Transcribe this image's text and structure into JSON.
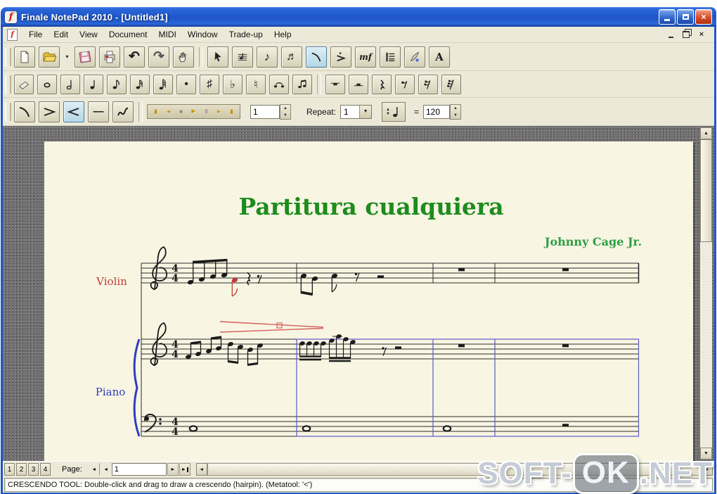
{
  "window": {
    "title": "Finale NotePad 2010 - [Untitled1]"
  },
  "menu": {
    "items": [
      "File",
      "Edit",
      "View",
      "Document",
      "MIDI",
      "Window",
      "Trade-up",
      "Help"
    ]
  },
  "transport": {
    "measure": "1",
    "repeat_label": "Repeat:",
    "repeat_value": "1",
    "equals": "=",
    "tempo": "120"
  },
  "score": {
    "title": "Partitura cualquiera",
    "composer": "Johnny Cage Jr.",
    "violin_label": "Violin",
    "piano_label": "Piano",
    "ts_top": "4",
    "ts_bottom": "4"
  },
  "page_nav": {
    "staff_sets": [
      "1",
      "2",
      "3",
      "4"
    ],
    "page_label": "Page:",
    "page_value": "1"
  },
  "status": {
    "message": "CRESCENDO TOOL: Double-click and drag to draw a crescendo (hairpin). (Metatool: '<')"
  },
  "watermark": {
    "left": "SOFT-",
    "mid": "OK",
    "right": ".NET"
  },
  "colors": {
    "titlebar_blue": "#1e55c8",
    "page_cream": "#f8f5e3",
    "title_green": "#1e8c1e",
    "violin_red": "#c03a3a",
    "piano_blue": "#2e3ec0",
    "hairpin_red": "#d96060",
    "selection_blue": "#b4d7e6"
  },
  "icons": {
    "up": "▲",
    "down": "▼",
    "open_caret": "▾",
    "dropdown": "▼",
    "undo": "↶",
    "redo": "↷",
    "sharp": "♯",
    "flat": "♭",
    "natural": "♮",
    "dot": "•",
    "expression": "mf",
    "text_tool": "A",
    "line_tool": "—",
    "go_start": "▮",
    "rewind": "◄",
    "stop": "■",
    "play": "►",
    "pause": "‖",
    "forward": "►",
    "go_end": "▮",
    "scroll_up": "▲",
    "scroll_down": "▼",
    "scroll_left": "◄",
    "scroll_right": "►",
    "nav_first": "◄",
    "nav_prev": "◄",
    "nav_next": "►",
    "nav_last": "►",
    "mdi_close": "×"
  }
}
